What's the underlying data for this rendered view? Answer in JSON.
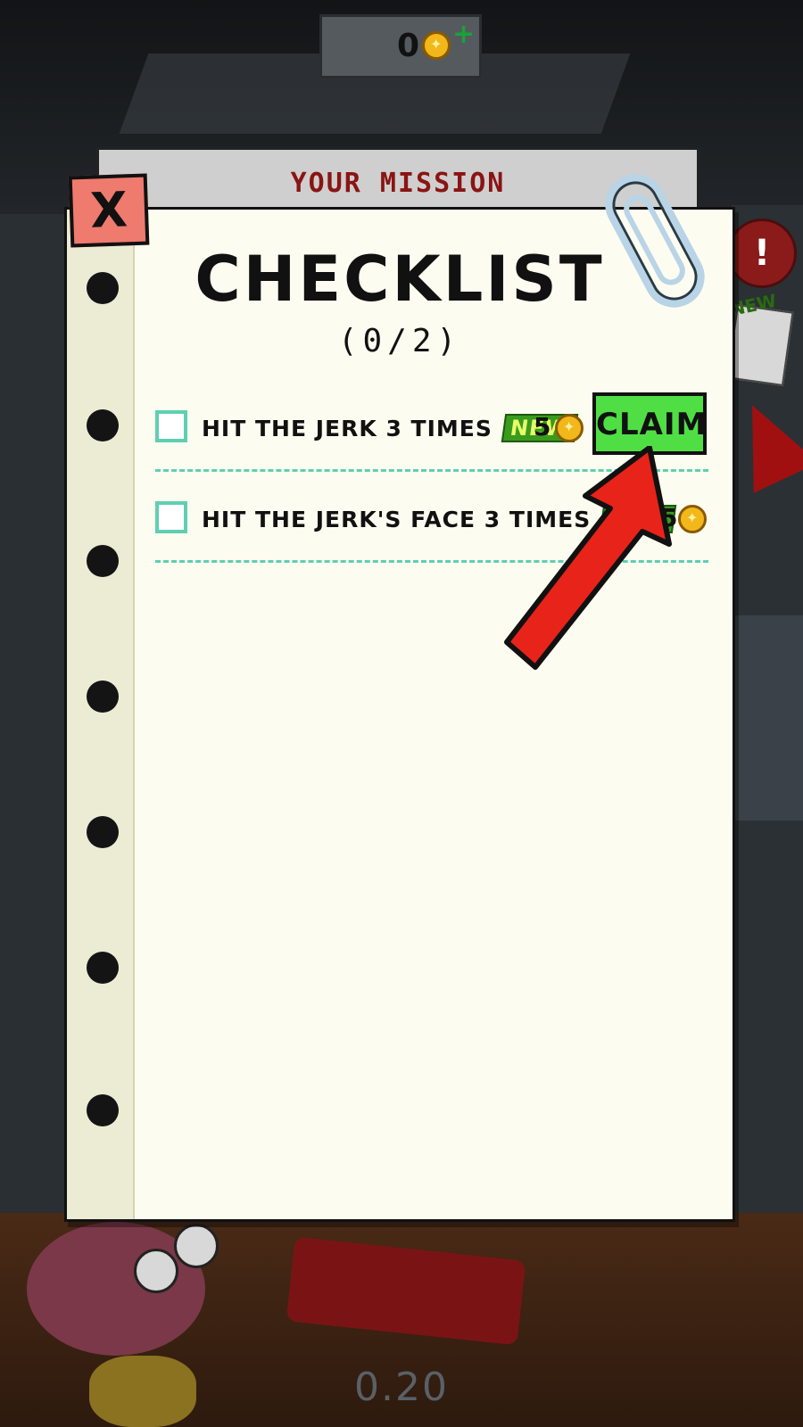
{
  "hud": {
    "coins": "0"
  },
  "mission": {
    "tab_title": "YOUR MISSION",
    "heading": "CHECKLIST",
    "progress": "(0/2)",
    "close_label": "X",
    "tasks": [
      {
        "label": "HIT THE JERK 3 TIMES",
        "badge": "NEW",
        "reward": "5",
        "checked": false,
        "claimable": true
      },
      {
        "label": "HIT THE JERK'S FACE 3 TIMES",
        "badge": "NEW",
        "reward": "5",
        "checked": false,
        "claimable": false
      }
    ],
    "claim_label": "CLAIM"
  },
  "footer": {
    "timer": "0.20"
  },
  "side": {
    "warning_symbol": "!",
    "mini_badge": "NEW"
  },
  "colors": {
    "claim_green": "#4fdf45",
    "close_red": "#ef7a6e",
    "checkbox_teal": "#5fcfb2",
    "mission_title_red": "#8a1414",
    "arrow_red": "#e8231a"
  },
  "icons": {
    "coin": "coin-icon",
    "paperclip": "paperclip-icon",
    "close": "close-icon",
    "arrow": "tutorial-arrow-icon",
    "wifi_warning": "no-connection-icon"
  }
}
